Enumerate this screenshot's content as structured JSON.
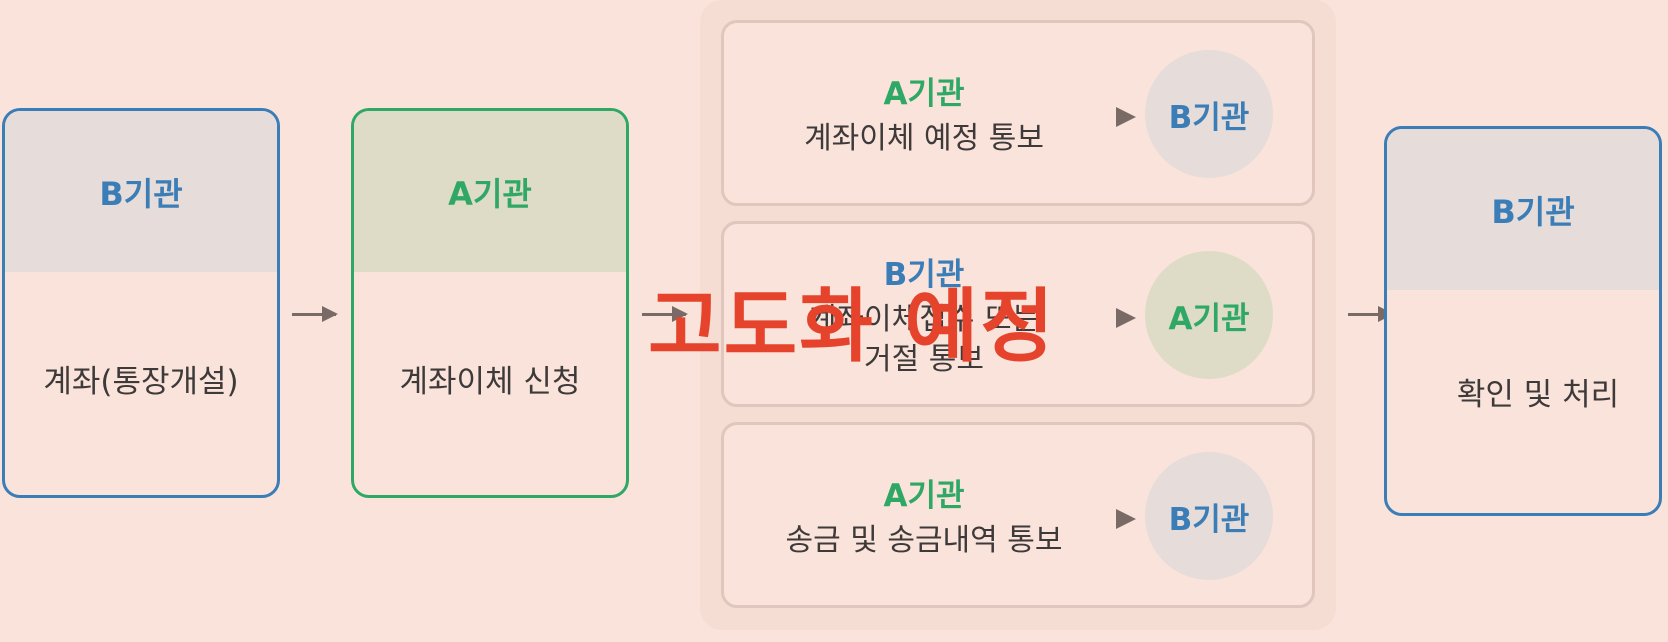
{
  "step1": {
    "org": "B기관",
    "text": "계좌(통장개설)"
  },
  "step2": {
    "org": "A기관",
    "text": "계좌이체 신청"
  },
  "exchanges": [
    {
      "from": "A기관",
      "text": "계좌이체 예정 통보",
      "to": "B기관"
    },
    {
      "from": "B기관",
      "text": "계좌이체접수 또는 거절 통보",
      "to": "A기관"
    },
    {
      "from": "A기관",
      "text": "송금 및 송금내역 통보",
      "to": "B기관"
    }
  ],
  "step4": {
    "org": "B기관",
    "text": "확인 및 처리"
  },
  "watermark": "고도화 예정",
  "colors": {
    "blue": "#3b7db6",
    "green": "#2fa866",
    "watermark": "#e5432c",
    "background": "#f9e3db"
  }
}
